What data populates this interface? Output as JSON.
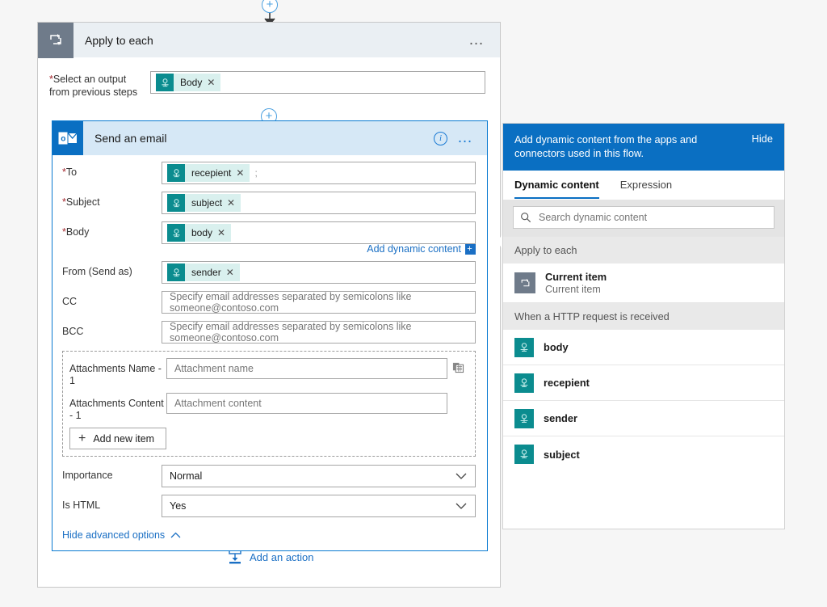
{
  "loop": {
    "title": "Apply to each",
    "icon": "loop-icon",
    "menu": "…",
    "select_output": {
      "label_line1": "Select an output",
      "label_line2": "from previous steps",
      "required": true,
      "token": "Body",
      "token_remove": "✕"
    }
  },
  "email_card": {
    "title": "Send an email",
    "icon": "outlook-icon",
    "info": "i",
    "menu": "…",
    "fields": [
      {
        "label": "To",
        "required": true,
        "token": "recepient",
        "trailing": ";"
      },
      {
        "label": "Subject",
        "required": true,
        "token": "subject",
        "trailing": ""
      },
      {
        "label": "Body",
        "required": true,
        "token": "body",
        "trailing": ""
      }
    ],
    "add_dynamic_content": {
      "label": "Add dynamic content",
      "badge": "+"
    },
    "from": {
      "label": "From (Send as)",
      "token": "sender"
    },
    "cc": {
      "label": "CC",
      "placeholder": "Specify email addresses separated by semicolons like someone@contoso.com"
    },
    "bcc": {
      "label": "BCC",
      "placeholder": "Specify email addresses separated by semicolons like someone@contoso.com"
    },
    "attachments": {
      "name_label": "Attachments Name - 1",
      "name_placeholder": "Attachment name",
      "content_label": "Attachments Content - 1",
      "content_placeholder": "Attachment content",
      "add_new_item": "Add new item",
      "side_icon": "delete-item-icon"
    },
    "importance": {
      "label": "Importance",
      "value": "Normal"
    },
    "is_html": {
      "label": "Is HTML",
      "value": "Yes"
    },
    "hide_advanced": "Hide advanced options",
    "token_remove": "✕"
  },
  "add_action": {
    "label": "Add an action",
    "icon": "add-action-icon"
  },
  "dynamic_panel": {
    "banner_text": "Add dynamic content from the apps and connectors used in this flow.",
    "hide_label": "Hide",
    "tabs": [
      {
        "label": "Dynamic content",
        "active": true
      },
      {
        "label": "Expression",
        "active": false
      }
    ],
    "search_placeholder": "Search dynamic content",
    "groups": [
      {
        "header": "Apply to each",
        "items": [
          {
            "title": "Current item",
            "subtitle": "Current item",
            "icon": "loop-icon"
          }
        ]
      },
      {
        "header": "When a HTTP request is received",
        "items": [
          {
            "title": "body",
            "icon": "dynamic-token-icon"
          },
          {
            "title": "recepient",
            "icon": "dynamic-token-icon"
          },
          {
            "title": "sender",
            "icon": "dynamic-token-icon"
          },
          {
            "title": "subject",
            "icon": "dynamic-token-icon"
          }
        ]
      }
    ]
  },
  "connectors": {
    "top_plus": "+",
    "mid_plus": "+"
  },
  "colors": {
    "accent_blue": "#0a6fc2",
    "token_teal": "#0b8c8f",
    "token_bg": "#d9f0ee",
    "loop_gray": "#6f7b8a",
    "required_red": "#a4262c"
  }
}
